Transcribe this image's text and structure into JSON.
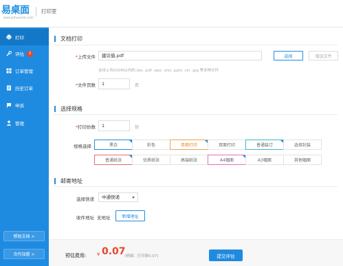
{
  "header": {
    "logo": "易桌面",
    "logo_sub": "www.yizhuomian.com",
    "title": "打印室"
  },
  "sidebar": {
    "items": [
      {
        "label": "打印",
        "icon": "printer-icon"
      },
      {
        "label": "评估",
        "icon": "wrench-icon",
        "badge": "2"
      },
      {
        "label": "订单管理",
        "icon": "grid-icon"
      },
      {
        "label": "历史订单",
        "icon": "document-icon"
      },
      {
        "label": "申诉",
        "icon": "flag-icon"
      },
      {
        "label": "管理",
        "icon": "user-icon"
      }
    ],
    "help_button": "帮助文档 >",
    "partner_button": "合作加盟 >"
  },
  "doc_section": {
    "title": "文档打印",
    "upload_label": "上传文件",
    "file_name": "建议值.pdf",
    "select_button": "选择",
    "add_button": "增加文件",
    "hint": "支持上传500M以内的.doc .pdf .wps .xlsx .pptx .rar .jpg 等多种文件",
    "pages_label": "文件页数",
    "pages_value": "1",
    "pages_unit": "页"
  },
  "spec_section": {
    "title": "选择规格",
    "copies_label": "打印份数",
    "copies_value": "1",
    "copies_unit": "份",
    "spec_label": "规格选择",
    "options_row1": [
      "黑白",
      "彩色",
      "单面打印",
      "双面打印",
      "普通装订",
      "选择封装"
    ],
    "options_row2": [
      "普通纸张",
      "优质纸张",
      "高端纸张",
      "A4幅面",
      "A3幅面",
      "其他幅面"
    ]
  },
  "mail_section": {
    "title": "邮寄地址",
    "express_label": "选择快递",
    "express_value": "中通快递",
    "address_label": "收件地址",
    "address_value": "无地址",
    "new_address_button": "新增地址"
  },
  "footer": {
    "price_label": "预估费用:",
    "currency": "¥",
    "price": "0.07",
    "price_note": "(明细：打印费0.07)",
    "submit_button": "提交评估"
  },
  "colors": {
    "primary": "#1f8be0",
    "accent_red": "#e8452c",
    "orange": "#f0a050",
    "teal": "#38b8c8",
    "pink": "#e070c0",
    "red_border": "#e86a6a"
  }
}
